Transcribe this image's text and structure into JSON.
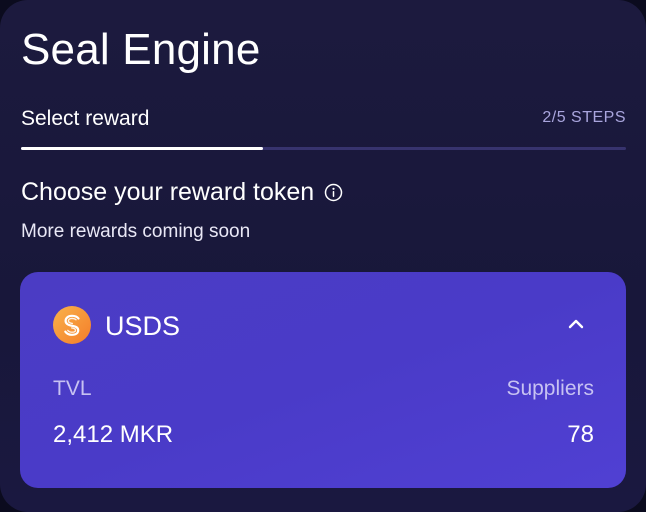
{
  "header": {
    "title": "Seal Engine"
  },
  "stepper": {
    "label": "Select reward",
    "count": "2/5 STEPS",
    "progress": 0.4
  },
  "section": {
    "heading": "Choose your reward token",
    "subheading": "More rewards coming soon"
  },
  "token": {
    "name": "USDS",
    "logo_icon": "usds-coin-icon",
    "tvl_label": "TVL",
    "tvl_value": "2,412 MKR",
    "suppliers_label": "Suppliers",
    "suppliers_value": "78",
    "expanded": true
  },
  "colors": {
    "card_background": "#1c1a3e",
    "token_card": "#4a3bc8",
    "accent_muted": "#a9a5dd",
    "coin_orange": "#f7a53a"
  }
}
